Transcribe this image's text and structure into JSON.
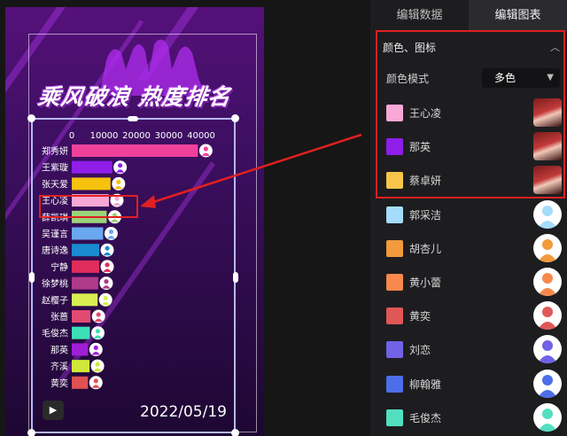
{
  "poster": {
    "title": "乘风破浪 热度排名",
    "date": "2022/05/19",
    "play_icon": "play-icon"
  },
  "chart_data": {
    "type": "bar",
    "title": "",
    "xlabel": "",
    "ylabel": "",
    "xticks": [
      "0",
      "10000",
      "20000",
      "30000",
      "40000"
    ],
    "xlim": [
      0,
      43000
    ],
    "categories": [
      "郑秀妍",
      "王紫璇",
      "张天爱",
      "王心凌",
      "薛凯琪",
      "吴谨言",
      "唐诗逸",
      "宁静",
      "徐梦桃",
      "赵樱子",
      "张蔷",
      "毛俊杰",
      "那英",
      "齐溪",
      "黄奕"
    ],
    "values": [
      39000,
      12500,
      12000,
      11500,
      10800,
      9700,
      8500,
      8500,
      8200,
      8000,
      5800,
      5600,
      5000,
      5500,
      5000
    ],
    "colors": [
      "#f0419a",
      "#8e1ee8",
      "#f5c20e",
      "#f7a8d6",
      "#9bd37a",
      "#6aa8f0",
      "#1a8bd0",
      "#e02d5c",
      "#b03a8a",
      "#d7ef52",
      "#e24a72",
      "#3de0b6",
      "#a01ed8",
      "#cfe83a",
      "#e05050"
    ]
  },
  "panel": {
    "tabs": [
      {
        "label": "编辑数据"
      },
      {
        "label": "编辑图表"
      }
    ],
    "section_title": "颜色、图标",
    "color_mode_label": "颜色模式",
    "color_mode_value": "多色",
    "items": [
      {
        "name": "王心凌",
        "color": "#f7a8d6",
        "avatar": "photo"
      },
      {
        "name": "那英",
        "color": "#8e1ee8",
        "avatar": "photo"
      },
      {
        "name": "蔡卓妍",
        "color": "#f5c64a",
        "avatar": "photo"
      },
      {
        "name": "郭采洁",
        "color": "#a5dcfb",
        "avatar": "silhouette"
      },
      {
        "name": "胡杏儿",
        "color": "#f29a3c",
        "avatar": "silhouette"
      },
      {
        "name": "黄小蕾",
        "color": "#f7894d",
        "avatar": "silhouette"
      },
      {
        "name": "黄奕",
        "color": "#e05757",
        "avatar": "silhouette"
      },
      {
        "name": "刘恋",
        "color": "#7162e6",
        "avatar": "silhouette"
      },
      {
        "name": "柳翰雅",
        "color": "#4d6ee8",
        "avatar": "silhouette"
      },
      {
        "name": "毛俊杰",
        "color": "#52dfc0",
        "avatar": "silhouette"
      }
    ]
  }
}
